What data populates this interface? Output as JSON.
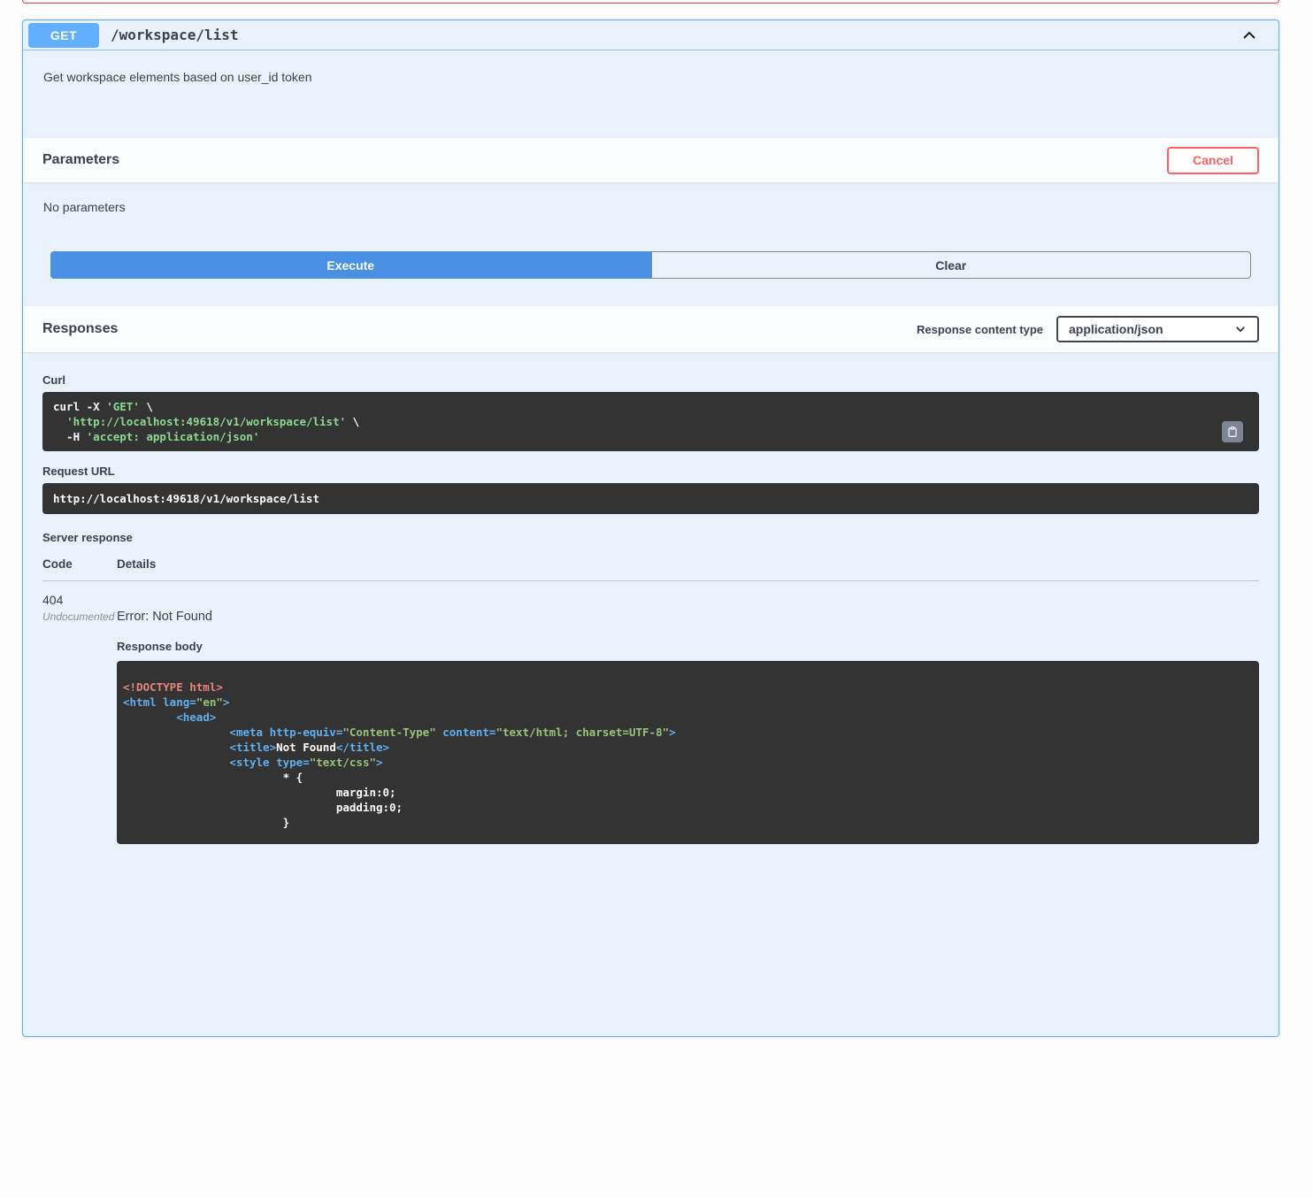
{
  "endpoint": {
    "method": "GET",
    "path": "/workspace/list",
    "description": "Get workspace elements based on user_id token"
  },
  "parameters": {
    "title": "Parameters",
    "cancel_label": "Cancel",
    "empty_text": "No parameters",
    "execute_label": "Execute",
    "clear_label": "Clear"
  },
  "responses": {
    "title": "Responses",
    "content_type_label": "Response content type",
    "content_type_value": "application/json",
    "curl_label": "Curl",
    "request_url_label": "Request URL",
    "request_url": "http://localhost:49618/v1/workspace/list",
    "server_response_label": "Server response",
    "table": {
      "code_header": "Code",
      "details_header": "Details",
      "rows": [
        {
          "code": "404",
          "code_note": "Undocumented",
          "description": "Error: Not Found"
        }
      ]
    },
    "response_body_label": "Response body"
  },
  "curl_command": {
    "lines": [
      [
        [
          "plain",
          "curl -X "
        ],
        [
          "str",
          "'GET'"
        ],
        [
          "plain",
          " \\"
        ]
      ],
      [
        [
          "plain",
          "  "
        ],
        [
          "str",
          "'http://localhost:49618/v1/workspace/list'"
        ],
        [
          "plain",
          " \\"
        ]
      ],
      [
        [
          "plain",
          "  -H "
        ],
        [
          "str",
          "'accept: application/json'"
        ]
      ]
    ]
  },
  "response_body": {
    "lines": [
      [
        [
          "red",
          "<!DOCTYPE html>"
        ]
      ],
      [
        [
          "tag",
          "<html lang="
        ],
        [
          "str",
          "\"en\""
        ],
        [
          "tag",
          ">"
        ]
      ],
      [
        [
          "plain",
          "\t"
        ],
        [
          "tag",
          "<head>"
        ]
      ],
      [
        [
          "plain",
          "\t\t"
        ],
        [
          "tag",
          "<meta http-equiv="
        ],
        [
          "str",
          "\"Content-Type\""
        ],
        [
          "tag",
          " content="
        ],
        [
          "str",
          "\"text/html; charset=UTF-8\""
        ],
        [
          "tag",
          ">"
        ]
      ],
      [
        [
          "plain",
          "\t\t"
        ],
        [
          "tag",
          "<title>"
        ],
        [
          "plain",
          "Not Found"
        ],
        [
          "tag",
          "</title>"
        ]
      ],
      [
        [
          "plain",
          "\t\t"
        ],
        [
          "tag",
          "<style type="
        ],
        [
          "str",
          "\"text/css\""
        ],
        [
          "tag",
          ">"
        ]
      ],
      [
        [
          "plain",
          "\t\t\t* {"
        ]
      ],
      [
        [
          "plain",
          "\t\t\t\tmargin:0;"
        ]
      ],
      [
        [
          "plain",
          "\t\t\t\tpadding:0;"
        ]
      ],
      [
        [
          "plain",
          "\t\t\t}"
        ]
      ]
    ]
  },
  "icons": {
    "collapse": "chevron-up-icon",
    "select_arrow": "chevron-down-icon",
    "copy": "clipboard-icon"
  },
  "colors": {
    "method_get_badge": "#61affe",
    "panel_border": "#61affe",
    "panel_bg": "#e9f1fb",
    "execute_button": "#4990e2",
    "cancel_button": "#ff6060",
    "code_block_bg": "#333333",
    "curl_string_green": "#8bd98f",
    "code_string_green": "#98c379",
    "code_tag_blue": "#61afef",
    "code_doctype_red": "#e8827d",
    "text_dark": "#3b4151",
    "adjacent_block_border_red": "#f93e3e"
  }
}
